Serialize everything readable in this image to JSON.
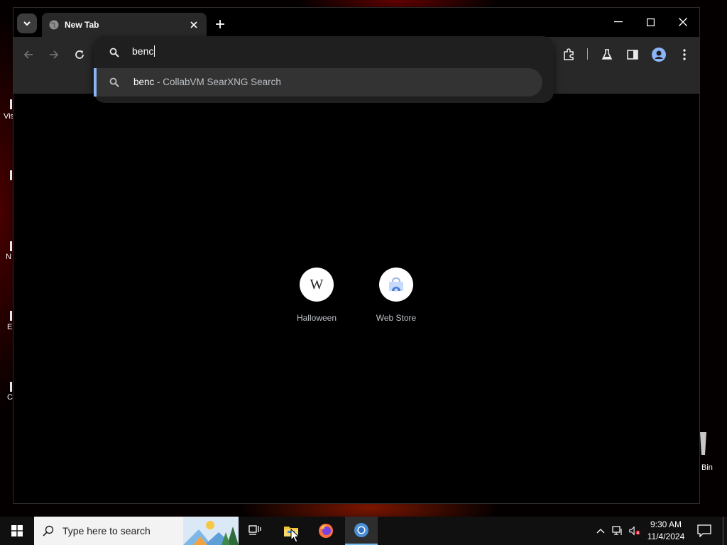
{
  "window": {
    "tab_title": "New Tab",
    "omnibox": {
      "input_value": "benc",
      "suggestion": {
        "query": "benc",
        "separator": " - ",
        "engine": "CollabVM SearXNG Search"
      }
    }
  },
  "shortcuts": [
    {
      "label": "Halloween",
      "icon": "W"
    },
    {
      "label": "Web Store",
      "icon": "webstore-icon"
    }
  ],
  "desktop": {
    "icon_labels": [
      "Vis",
      "N",
      "E",
      "C",
      "Bin"
    ]
  },
  "taskbar": {
    "search_placeholder": "Type here to search",
    "clock_time": "9:30 AM",
    "clock_date": "11/4/2024"
  },
  "colors": {
    "accent": "#8ab4f8",
    "toolbar": "#282828",
    "omnibox": "#1f1f1f",
    "taskbar_active": "#76b9ed"
  }
}
